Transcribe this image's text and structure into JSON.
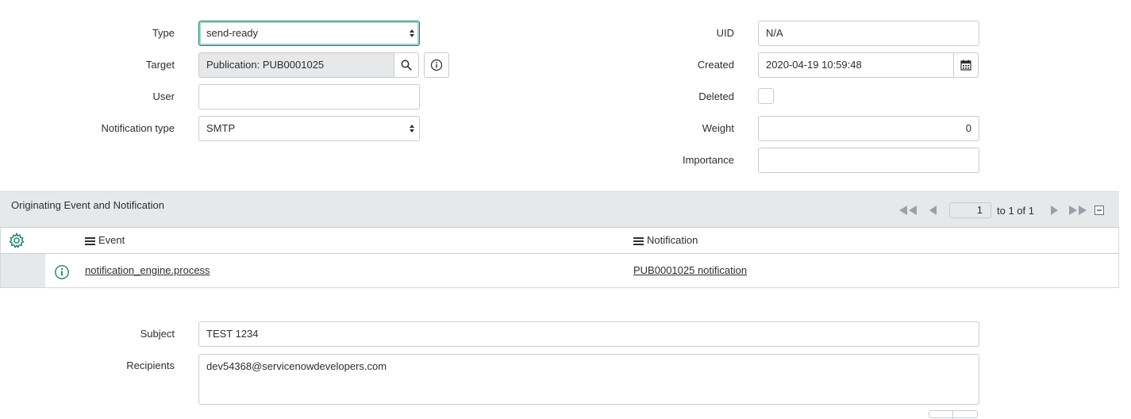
{
  "form": {
    "type": {
      "label": "Type",
      "value": "send-ready"
    },
    "target": {
      "label": "Target",
      "value": "Publication: PUB0001025"
    },
    "user": {
      "label": "User",
      "value": ""
    },
    "notification_type": {
      "label": "Notification type",
      "value": "SMTP"
    },
    "uid": {
      "label": "UID",
      "value": "N/A"
    },
    "created": {
      "label": "Created",
      "value": "2020-04-19 10:59:48"
    },
    "deleted": {
      "label": "Deleted"
    },
    "weight": {
      "label": "Weight",
      "value": "0"
    },
    "importance": {
      "label": "Importance",
      "value": ""
    },
    "subject": {
      "label": "Subject",
      "value": "TEST 1234"
    },
    "recipients": {
      "label": "Recipients",
      "value": "dev54368@servicenowdevelopers.com"
    }
  },
  "related_list": {
    "title": "Originating Event and Notification",
    "pager": {
      "page": "1",
      "range": "to 1 of 1"
    },
    "columns": [
      "Event",
      "Notification"
    ],
    "rows": [
      {
        "event": "notification_engine.process",
        "notification": "PUB0001025 notification"
      }
    ]
  },
  "colors": {
    "accent": "#1f8476",
    "header_bg": "#e6e8ea",
    "border": "#c8ccd0"
  },
  "icons": [
    "search-icon",
    "info-icon",
    "calendar-icon",
    "gear-icon",
    "first-page-icon",
    "prev-page-icon",
    "next-page-icon",
    "last-page-icon",
    "collapse-icon",
    "column-menu-icon"
  ]
}
